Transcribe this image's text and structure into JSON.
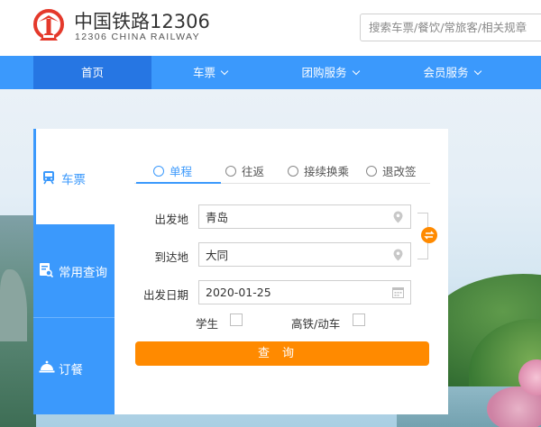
{
  "brand": {
    "title": "中国铁路12306",
    "subtitle": "12306 CHINA RAILWAY",
    "logo_color": "#e4392b"
  },
  "search": {
    "placeholder": "搜索车票/餐饮/常旅客/相关规章"
  },
  "nav": {
    "items": [
      {
        "label": "首页",
        "active": true
      },
      {
        "label": "车票"
      },
      {
        "label": "团购服务"
      },
      {
        "label": "会员服务"
      }
    ],
    "bg_color": "#3b99fc",
    "active_color": "#2676e3"
  },
  "side_tabs": [
    {
      "label": "车票",
      "icon": "train-icon",
      "active": true
    },
    {
      "label": "常用查询",
      "icon": "document-search-icon"
    },
    {
      "label": "订餐",
      "icon": "cloche-icon"
    }
  ],
  "trip_types": [
    {
      "label": "单程",
      "icon": "minus-circle-icon",
      "active": true
    },
    {
      "label": "往返",
      "icon": "equals-circle-icon"
    },
    {
      "label": "接续换乘",
      "icon": "cycle-circle-icon"
    },
    {
      "label": "退改签",
      "icon": "list-circle-icon"
    }
  ],
  "form": {
    "from_label": "出发地",
    "from_value": "青岛",
    "to_label": "到达地",
    "to_value": "大同",
    "date_label": "出发日期",
    "date_value": "2020-01-25",
    "student_label": "学生",
    "highspeed_label": "高铁/动车",
    "query_label": "查询"
  },
  "accent_color": "#ff8a00"
}
